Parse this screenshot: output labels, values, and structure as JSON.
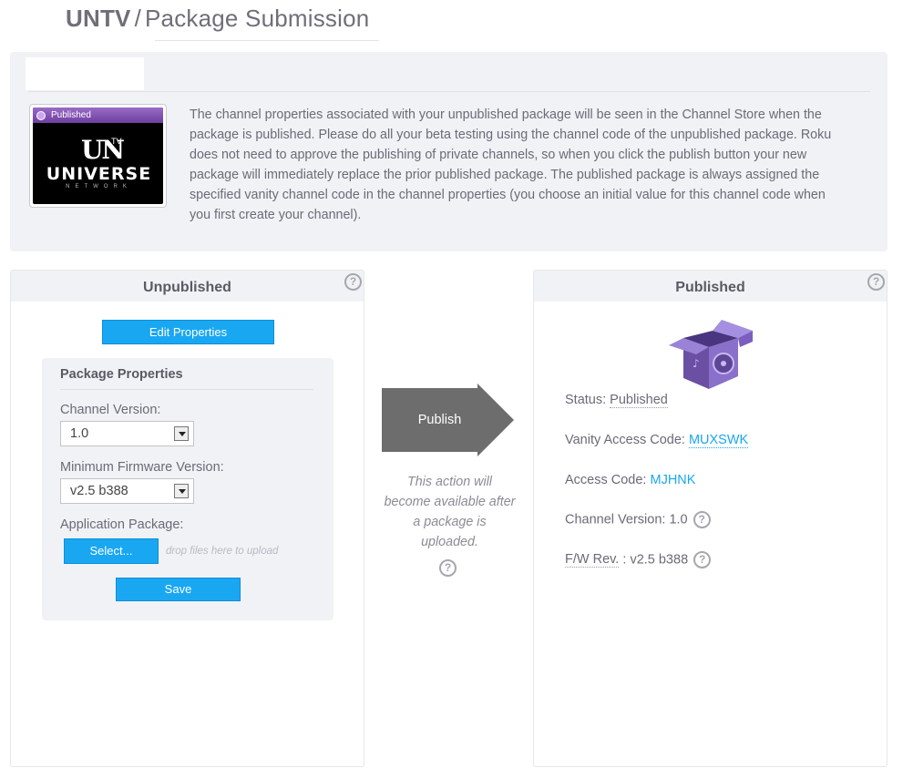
{
  "header": {
    "app": "UNTV",
    "separator": "/",
    "page": "Package Submission"
  },
  "info": {
    "thumbnail_badge": "Published",
    "logo_un": "UN",
    "logo_tv": "TV",
    "logo_universe": "UNIVERSE",
    "logo_network": "NETWORK",
    "text": "The channel properties associated with your unpublished package will be seen in the Channel Store when the package is published. Please do all your beta testing using the channel code of the unpublished package. Roku does not need to approve the publishing of private channels, so when you click the publish button your new package will immediately replace the prior published package. The published package is always assigned the specified vanity channel code in the channel properties (you choose an initial value for this channel code when you first create your channel)."
  },
  "unpublished": {
    "title": "Unpublished",
    "edit_button": "Edit Properties",
    "package_properties": {
      "title": "Package Properties",
      "channel_version_label": "Channel Version:",
      "channel_version_value": "1.0",
      "min_firmware_label": "Minimum Firmware Version:",
      "min_firmware_value": "v2.5 b388",
      "app_package_label": "Application Package:",
      "select_button": "Select...",
      "drop_hint": "drop files here to upload",
      "save_button": "Save"
    }
  },
  "publish": {
    "button": "Publish",
    "note": "This action will become available after a package is uploaded."
  },
  "published": {
    "title": "Published",
    "status_label": "Status:",
    "status_value": "Published",
    "vanity_label": "Vanity Access Code:",
    "vanity_value": "MUXSWK",
    "access_label": "Access Code:",
    "access_value": "MJHNK",
    "channel_version_label": "Channel Version:",
    "channel_version_value": "1.0",
    "fw_label": "F/W Rev.",
    "fw_sep": ":",
    "fw_value": "v2.5 b388"
  },
  "icons": {
    "help": "?"
  },
  "colors": {
    "accent": "#1aa7f2",
    "panel_bg": "#f1f2f5",
    "publish_arrow": "#6d6d6d",
    "box_purple": "#7c5fb6"
  }
}
